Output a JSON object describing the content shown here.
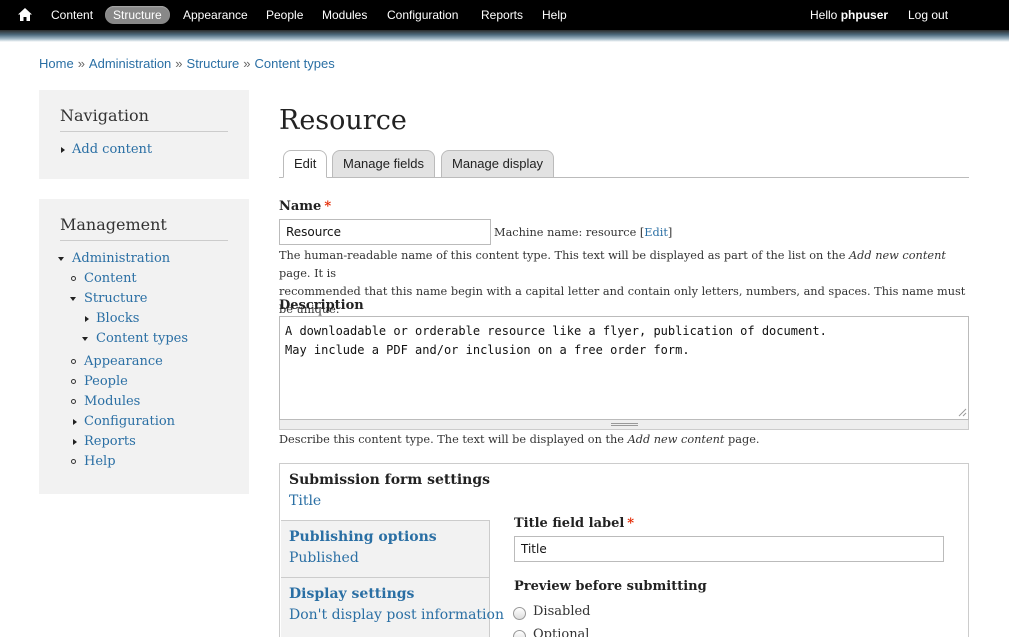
{
  "toolbar": {
    "items": [
      "Content",
      "Structure",
      "Appearance",
      "People",
      "Modules",
      "Configuration",
      "Reports",
      "Help"
    ],
    "active": "Structure",
    "hello_prefix": "Hello",
    "username": "phpuser",
    "logout": "Log out"
  },
  "breadcrumb": [
    "Home",
    "Administration",
    "Structure",
    "Content types"
  ],
  "navigation": {
    "title": "Navigation",
    "items": [
      "Add content"
    ]
  },
  "management": {
    "title": "Management",
    "items": [
      "Administration",
      "Content",
      "Structure",
      "Blocks",
      "Content types",
      "Appearance",
      "People",
      "Modules",
      "Configuration",
      "Reports",
      "Help"
    ]
  },
  "page": {
    "title": "Resource",
    "tabs": [
      "Edit",
      "Manage fields",
      "Manage display"
    ]
  },
  "form": {
    "name_label": "Name",
    "required_mark": "*",
    "name_value": "Resource",
    "machine_prefix": "Machine name: resource [",
    "machine_edit": "Edit",
    "machine_suffix": "]",
    "name_desc_1": "The human-readable name of this content type. This text will be displayed as part of the list on the ",
    "name_desc_em": "Add new content",
    "name_desc_2": " page. It is",
    "name_desc_3": "recommended that this name begin with a capital letter and contain only letters, numbers, and spaces. This name must be unique.",
    "description_label": "Description",
    "description_value": "A downloadable or orderable resource like a flyer, publication of document.\nMay include a PDF and/or inclusion on a free order form.",
    "description_desc_1": "Describe this content type. The text will be displayed on the ",
    "description_desc_em": "Add new content",
    "description_desc_2": " page."
  },
  "settings": {
    "legend": "Submission form settings",
    "legend_summary": "Title",
    "vtabs": [
      {
        "title": "Publishing options",
        "summary": "Published"
      },
      {
        "title": "Display settings",
        "summary": "Don't display post information"
      }
    ],
    "title_field_label": "Title field label",
    "title_field_value": "Title",
    "preview_label": "Preview before submitting",
    "preview_options": [
      "Disabled",
      "Optional"
    ]
  }
}
